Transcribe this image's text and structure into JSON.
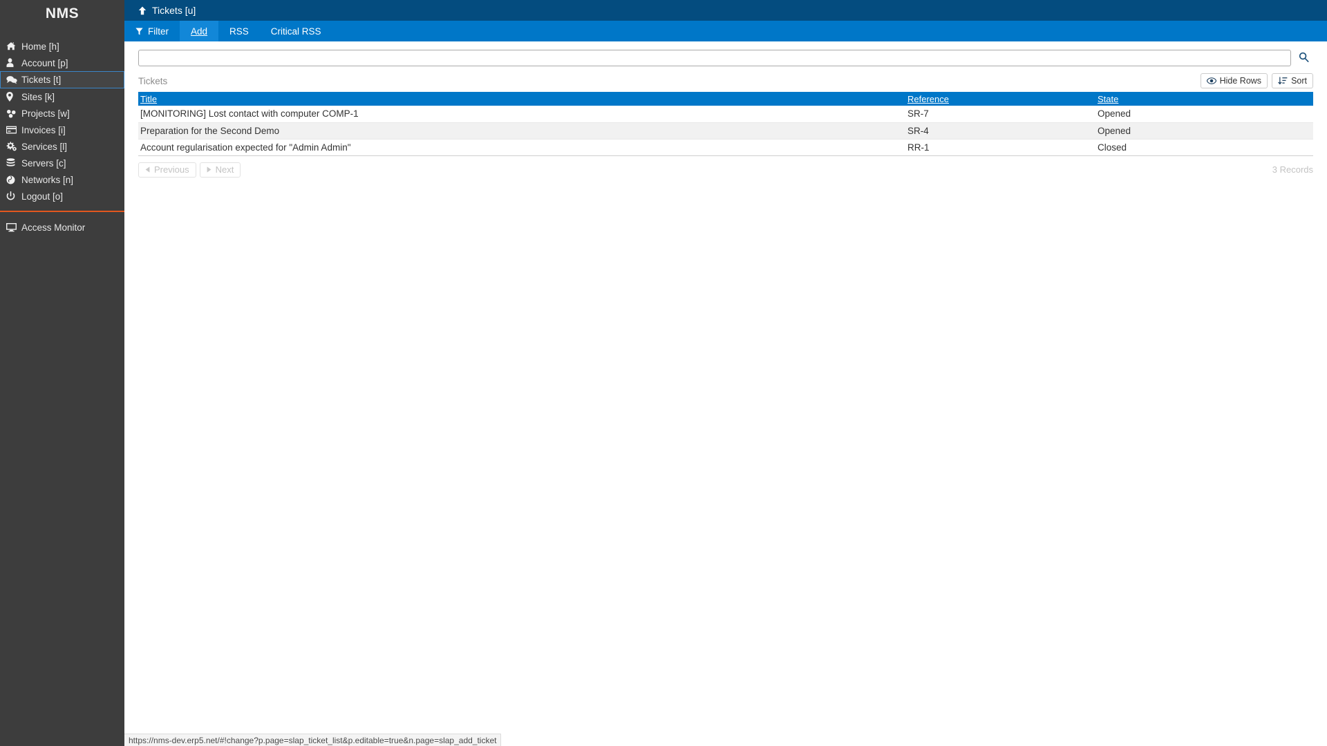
{
  "sidebar": {
    "brand": "NMS",
    "items": [
      {
        "label": "Home [h]",
        "icon": "home-icon"
      },
      {
        "label": "Account [p]",
        "icon": "user-icon"
      },
      {
        "label": "Tickets [t]",
        "icon": "comments-icon",
        "active": true
      },
      {
        "label": "Sites [k]",
        "icon": "map-marker-icon"
      },
      {
        "label": "Projects [w]",
        "icon": "cubes-icon"
      },
      {
        "label": "Invoices [i]",
        "icon": "credit-card-icon"
      },
      {
        "label": "Services [l]",
        "icon": "gears-icon"
      },
      {
        "label": "Servers [c]",
        "icon": "database-icon"
      },
      {
        "label": "Networks [n]",
        "icon": "globe-icon"
      },
      {
        "label": "Logout [o]",
        "icon": "power-icon"
      }
    ],
    "secondary_items": [
      {
        "label": "Access Monitor",
        "icon": "desktop-icon"
      }
    ],
    "divider_color": "#e2571e",
    "background": "#3d3d3d",
    "active_border": "#3b86c8"
  },
  "header": {
    "breadcrumb_label": "Tickets [u]",
    "up_icon": "arrow-up-icon",
    "background": "#044c7f"
  },
  "actionbar": {
    "background": "#0077c8",
    "selected_background": "#1287d8",
    "items": [
      {
        "label": "Filter",
        "icon": "filter-icon",
        "selected": false
      },
      {
        "label": "Add",
        "icon": "",
        "selected": true
      },
      {
        "label": "RSS",
        "icon": "",
        "selected": false
      },
      {
        "label": "Critical RSS",
        "icon": "",
        "selected": false
      }
    ]
  },
  "search": {
    "value": "",
    "placeholder": "",
    "button_icon": "search-icon"
  },
  "listing": {
    "title": "Tickets",
    "tools": [
      {
        "label": "Hide Rows",
        "icon": "eye-icon"
      },
      {
        "label": "Sort",
        "icon": "sort-icon"
      }
    ],
    "columns": [
      "Title",
      "Reference",
      "State"
    ],
    "rows": [
      {
        "title": "[MONITORING] Lost contact with computer COMP-1",
        "reference": "SR-7",
        "state": "Opened"
      },
      {
        "title": "Preparation for the Second Demo",
        "reference": "SR-4",
        "state": "Opened"
      },
      {
        "title": "Account regularisation expected for \"Admin Admin\"",
        "reference": "RR-1",
        "state": "Closed"
      }
    ],
    "pagination": {
      "previous_label": "Previous",
      "next_label": "Next",
      "previous_icon": "triangle-left-icon",
      "next_icon": "triangle-right-icon",
      "records_label": "3 Records"
    }
  },
  "statusbar": {
    "url": "https://nms-dev.erp5.net/#!change?p.page=slap_ticket_list&p.editable=true&n.page=slap_add_ticket"
  }
}
